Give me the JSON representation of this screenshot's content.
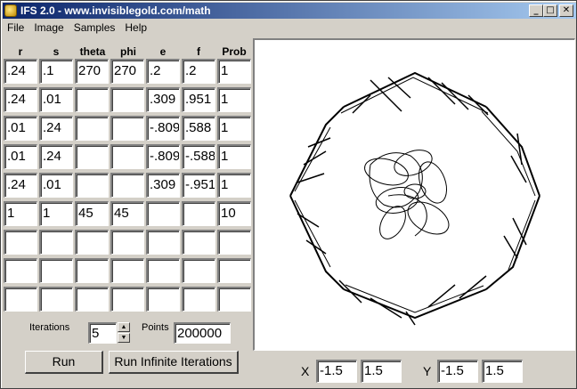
{
  "window": {
    "title": "IFS 2.0  - www.invisiblegold.com/math",
    "buttons": {
      "minimize": "_",
      "maximize": "□",
      "close": "✕"
    }
  },
  "menu": [
    "File",
    "Image",
    "Samples",
    "Help"
  ],
  "grid": {
    "headers": [
      "r",
      "s",
      "theta",
      "phi",
      "e",
      "f",
      "Prob"
    ],
    "rows": [
      [
        ".24",
        ".1",
        "270",
        "270",
        ".2",
        ".2",
        "1"
      ],
      [
        ".24",
        ".01",
        "",
        "",
        ".309",
        ".951",
        "1"
      ],
      [
        ".01",
        ".24",
        "",
        "",
        "-.809",
        ".588",
        "1"
      ],
      [
        ".01",
        ".24",
        "",
        "",
        "-.809",
        "-.588",
        "1"
      ],
      [
        ".24",
        ".01",
        "",
        "",
        ".309",
        "-.951",
        "1"
      ],
      [
        "1",
        "1",
        "45",
        "45",
        "",
        "",
        "10"
      ],
      [
        "",
        "",
        "",
        "",
        "",
        "",
        ""
      ],
      [
        "",
        "",
        "",
        "",
        "",
        "",
        ""
      ],
      [
        "",
        "",
        "",
        "",
        "",
        "",
        ""
      ]
    ]
  },
  "controls": {
    "iterations_label": "Iterations",
    "iterations_value": "5",
    "points_label": "Points",
    "points_value": "200000",
    "run_label": "Run",
    "run_infinite_label": "Run Infinite Iterations"
  },
  "range": {
    "x_label": "X",
    "x_min": "-1.5",
    "x_max": "1.5",
    "y_label": "Y",
    "y_min": "-1.5",
    "y_max": "1.5"
  }
}
